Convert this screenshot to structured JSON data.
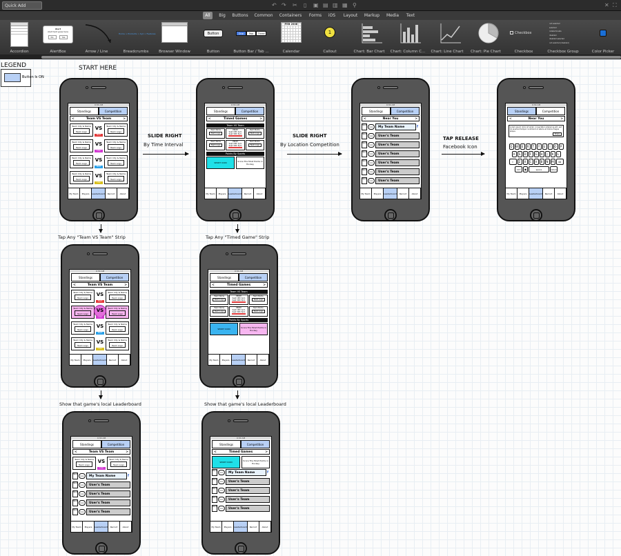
{
  "toolbar": {
    "quick_add": "Quick Add",
    "tabs": [
      "All",
      "Big",
      "Buttons",
      "Common",
      "Containers",
      "Forms",
      "iOS",
      "Layout",
      "Markup",
      "Media",
      "Text"
    ],
    "active_tab": "All"
  },
  "library": [
    {
      "label": "Accordion",
      "icon": "accordion-icon"
    },
    {
      "label": "AlertBox",
      "icon": "alertbox-icon",
      "title": "Alert",
      "body": "Alert text goes here",
      "buttons": [
        "No",
        "Yes"
      ]
    },
    {
      "label": "Arrow / Line",
      "icon": "arrow-line-icon"
    },
    {
      "label": "Breadcrumbs",
      "icon": "breadcrumbs-icon",
      "text": "Home > Products > Xyz > Features"
    },
    {
      "label": "Browser Window",
      "icon": "browser-window-icon"
    },
    {
      "label": "Button",
      "icon": "button-icon",
      "text": "Button"
    },
    {
      "label": "Button Bar / Tab ...",
      "icon": "button-bar-icon",
      "parts": [
        "One",
        "Two",
        "Three"
      ]
    },
    {
      "label": "Calendar",
      "icon": "calendar-icon",
      "text": "FEB 2008"
    },
    {
      "label": "Callout",
      "icon": "callout-icon",
      "text": "1"
    },
    {
      "label": "Chart: Bar Chart",
      "icon": "bar-chart-icon"
    },
    {
      "label": "Chart: Column C...",
      "icon": "column-chart-icon"
    },
    {
      "label": "Chart: Line Chart",
      "icon": "line-chart-icon"
    },
    {
      "label": "Chart: Pie Chart",
      "icon": "pie-chart-icon"
    },
    {
      "label": "Checkbox",
      "icon": "checkbox-icon",
      "text": "Checkbox"
    },
    {
      "label": "Checkbox Group",
      "icon": "checkbox-group-icon",
      "items": [
        "not selected",
        "selected",
        "indeterminate",
        "disabled",
        "disabled selected",
        "not selected (disabled)"
      ]
    },
    {
      "label": "Color Picker",
      "icon": "color-picker-icon"
    }
  ],
  "legend": {
    "title": "LEGEND",
    "item": "Button Is ON"
  },
  "labels": {
    "start": "START HERE",
    "slide_time_1": "SLIDE RIGHT",
    "slide_time_2": "By Time Interval",
    "slide_loc_1": "SLIDE RIGHT",
    "slide_loc_2": "By Location Competition",
    "tap_release_1": "TAP RELEASE",
    "tap_release_2": "Facebook Icon",
    "tap_vs": "Tap Any \"Team VS Team\" Strip",
    "tap_timed": "Tap Any \"Timed Game\" Strip",
    "show_lb_1": "Show that game's local Leaderboard",
    "show_lb_2": "Show that game's local Leaderboard"
  },
  "app": {
    "status": "9:30 AM",
    "seg_standings": "Standings",
    "seg_competition": "Competition",
    "title_vs": "Team VS Team",
    "title_timed": "Timed Games",
    "title_near": "Near You",
    "nav_prev": "<",
    "nav_next": ">",
    "team_name": "Team City & Name",
    "team_logo": "Team Logo",
    "vs": "VS",
    "tags": [
      "Start",
      "Live",
      "Start",
      "Live"
    ],
    "tab_bar": [
      "My Team",
      "Players",
      "Leaderboard",
      "Recruit",
      "About"
    ],
    "section_vs": "Team VS Team",
    "section_sports": "Points By Sports",
    "timed_name": "Team Name",
    "timed_info_1": "PROM",
    "timed_info_2": "Sept 16th 1pm",
    "timed_info_3": "Sept 30th 5pm",
    "sport_icon": "SPORT ICON",
    "sport_text": "Score The Most Points in Hockey",
    "rank": "Rank",
    "avatar": "Icon",
    "my_team": "My Team Name",
    "user_team": "User's Team",
    "message": "Lorem ipsum dolor sit amet, consectetur adipiscing elit, sed do eiusmod tempor incididunt ut labore et dolore magna aliqua.",
    "share": "Share",
    "kb_row1": [
      "Q",
      "W",
      "E",
      "R",
      "T",
      "Y",
      "U",
      "I",
      "O",
      "P"
    ],
    "kb_row2": [
      "A",
      "S",
      "D",
      "F",
      "G",
      "H",
      "J",
      "K",
      "L"
    ],
    "kb_row3": [
      "Z",
      "X",
      "C",
      "V",
      "B",
      "N",
      "M"
    ],
    "kb_shift": "⇧",
    "kb_del": "⌫",
    "kb_num": "123",
    "kb_globe": "◉",
    "kb_space": "space",
    "kb_return": "return"
  }
}
